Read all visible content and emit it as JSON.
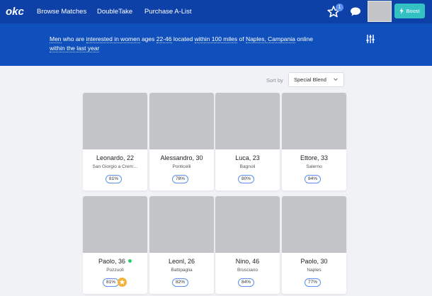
{
  "nav": {
    "logo": "okc",
    "browse_matches": "Browse Matches",
    "doubletake": "DoubleTake",
    "purchase_alist": "Purchase A-List",
    "star_badge_count": "1",
    "boost_label": "Boost",
    "icons": [
      "star-icon",
      "chat-bubble-icon",
      "lightning-icon"
    ]
  },
  "banner": {
    "p1": "Men",
    "p2": " who are ",
    "p3": "interested in women",
    "p4": " ages ",
    "p5": "22-46",
    "p6": " located ",
    "p7": "within 100 miles",
    "p8": " of ",
    "p9": "Naples, Campania",
    "p10": " online ",
    "p11": "within the last year",
    "filter_icon": "sliders-icon"
  },
  "sort": {
    "label": "Sort by",
    "selected": "Special Blend"
  },
  "profiles": [
    {
      "name": "Leonardo, 22",
      "location": "San Giorgio a Crem…",
      "match": "81%"
    },
    {
      "name": "Alessandro, 30",
      "location": "Ponticelli",
      "match": "78%"
    },
    {
      "name": "Luca, 23",
      "location": "Bagnoli",
      "match": "80%"
    },
    {
      "name": "Ettore, 33",
      "location": "Salerno",
      "match": "84%"
    },
    {
      "name": "Paolo, 36",
      "location": "Pozzuoli",
      "match": "81%",
      "online": true,
      "starred": true
    },
    {
      "name": "Leonl, 26",
      "location": "Battipaglia",
      "match": "82%"
    },
    {
      "name": "Nino, 46",
      "location": "Brusciano",
      "match": "84%"
    },
    {
      "name": "Paolo, 30",
      "location": "Naples",
      "match": "77%"
    }
  ],
  "colors": {
    "nav_bg": "#0d41a8",
    "banner_bg": "#1050bc",
    "boost_bg": "#34c1c4",
    "match_border": "#5b8ff0",
    "online": "#2ecc71",
    "star_chip": "#f0b33c"
  }
}
